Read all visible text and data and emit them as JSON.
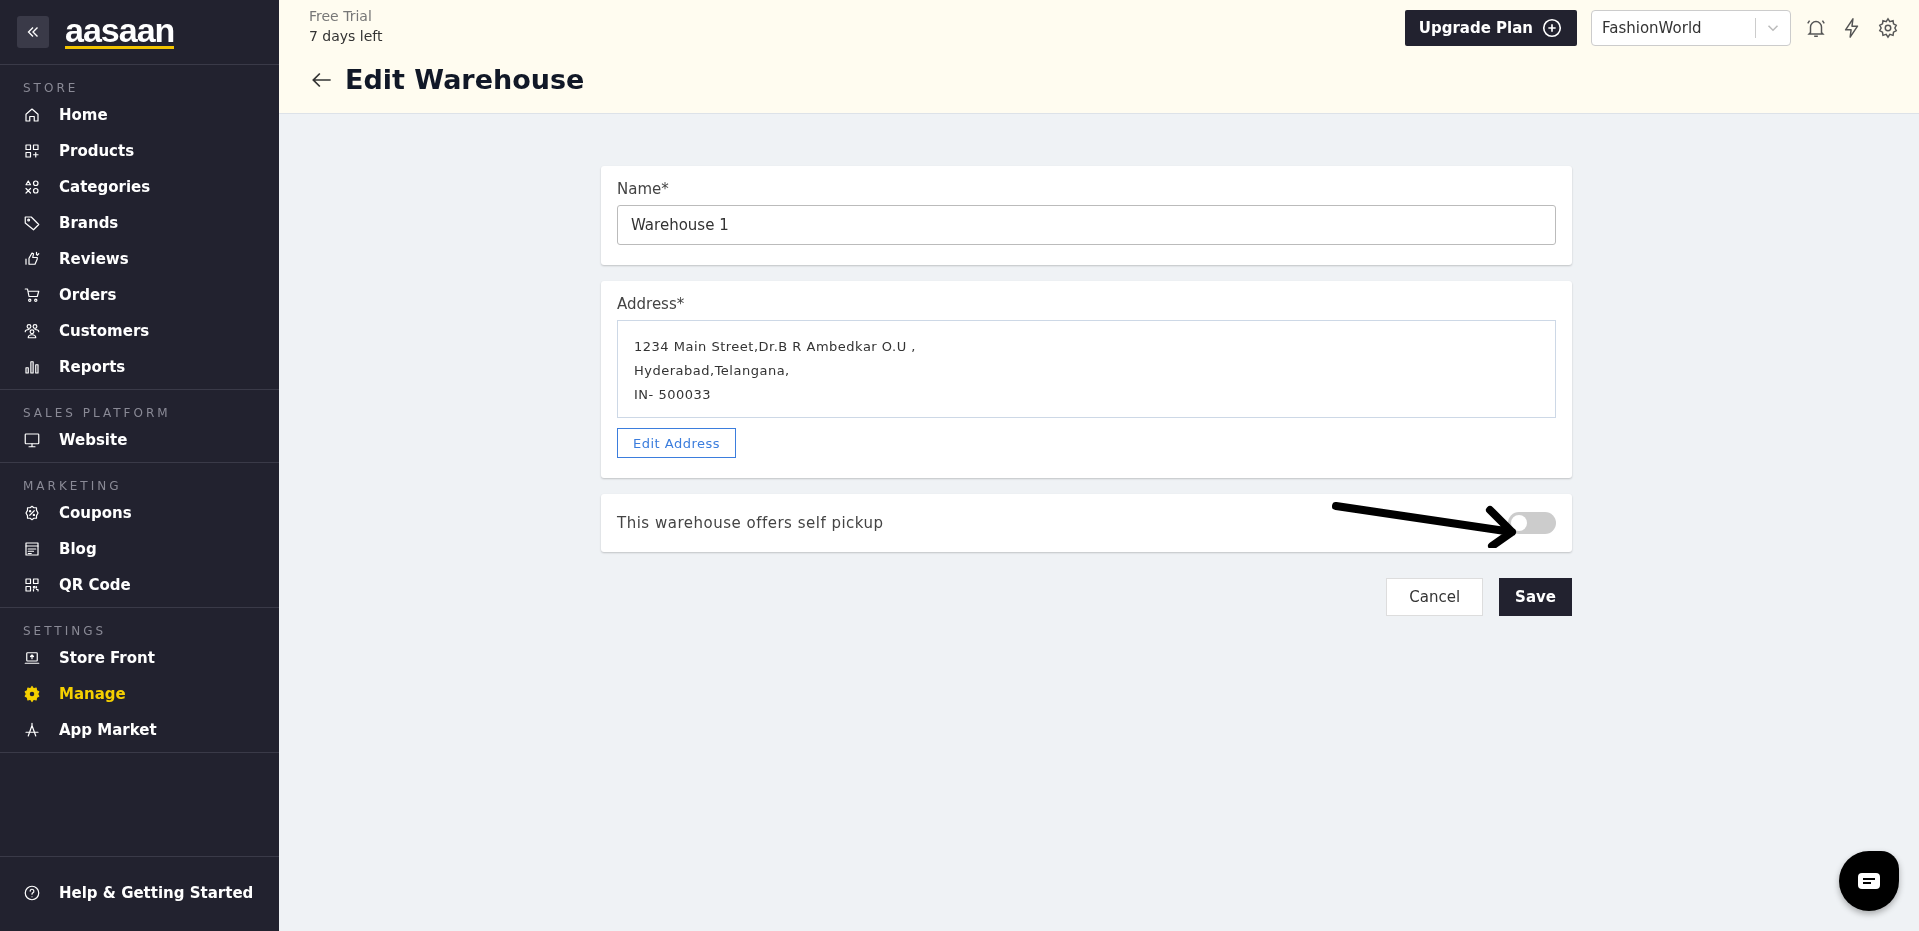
{
  "sidebar": {
    "logo": "aasaan",
    "sections": [
      {
        "title": "STORE",
        "items": [
          {
            "label": "Home",
            "selected": false
          },
          {
            "label": "Products",
            "selected": false
          },
          {
            "label": "Categories",
            "selected": false
          },
          {
            "label": "Brands",
            "selected": false
          },
          {
            "label": "Reviews",
            "selected": false
          },
          {
            "label": "Orders",
            "selected": false
          },
          {
            "label": "Customers",
            "selected": false
          },
          {
            "label": "Reports",
            "selected": false
          }
        ]
      },
      {
        "title": "SALES PLATFORM",
        "items": [
          {
            "label": "Website",
            "selected": false
          }
        ]
      },
      {
        "title": "MARKETING",
        "items": [
          {
            "label": "Coupons",
            "selected": false
          },
          {
            "label": "Blog",
            "selected": false
          },
          {
            "label": "QR Code",
            "selected": false
          }
        ]
      },
      {
        "title": "SETTINGS",
        "items": [
          {
            "label": "Store Front",
            "selected": false
          },
          {
            "label": "Manage",
            "selected": true
          },
          {
            "label": "App Market",
            "selected": false
          }
        ]
      }
    ],
    "footer": "Help & Getting Started"
  },
  "header": {
    "trial": "Free Trial",
    "days_left": "7 days left",
    "title": "Edit Warehouse",
    "upgrade": "Upgrade Plan",
    "store": "FashionWorld"
  },
  "form": {
    "name_label": "Name*",
    "name_value": "Warehouse 1",
    "address_label": "Address*",
    "address_lines": [
      "1234 Main Street,Dr.B R Ambedkar O.U ,",
      "Hyderabad,Telangana,",
      "IN- 500033"
    ],
    "edit_address": "Edit Address",
    "pickup_label": "This warehouse offers self pickup",
    "pickup_on": false
  },
  "actions": {
    "cancel": "Cancel",
    "save": "Save"
  }
}
